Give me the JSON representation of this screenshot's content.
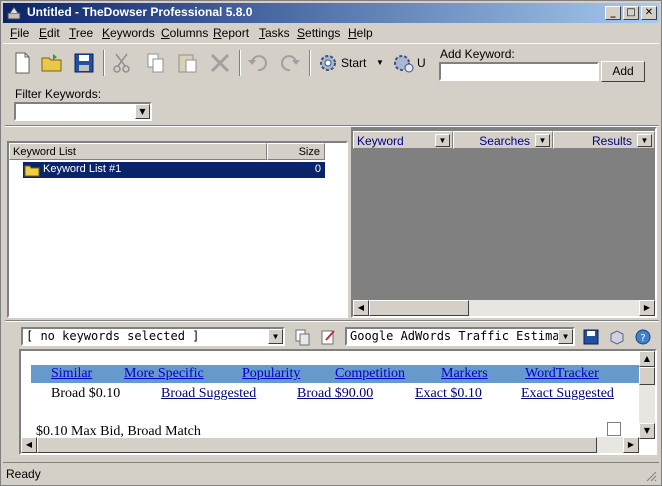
{
  "window": {
    "title": "Untitled - TheDowser Professional 5.8.0"
  },
  "menu": {
    "items": [
      {
        "label": "File",
        "ul": "F",
        "rest": "ile"
      },
      {
        "label": "Edit",
        "ul": "E",
        "rest": "dit"
      },
      {
        "label": "Tree",
        "ul": "T",
        "rest": "ree"
      },
      {
        "label": "Keywords",
        "ul": "K",
        "rest": "eywords"
      },
      {
        "label": "Columns",
        "ul": "C",
        "rest": "olumns"
      },
      {
        "label": "Report",
        "ul": "R",
        "rest": "eport"
      },
      {
        "label": "Tasks",
        "ul": "T",
        "rest": "asks"
      },
      {
        "label": "Settings",
        "ul": "S",
        "rest": "ettings"
      },
      {
        "label": "Help",
        "ul": "H",
        "rest": "elp"
      }
    ]
  },
  "toolbar": {
    "start_label": "Start",
    "update_label": "U",
    "add_keyword_label": "Add Keyword:",
    "add_keyword_value": "",
    "add_button": "Add",
    "icons": [
      "new-file-icon",
      "open-folder-icon",
      "save-icon",
      "cut-icon",
      "copy-icon",
      "paste-icon",
      "delete-icon",
      "undo-icon",
      "redo-icon",
      "gear-icon",
      "update-icon"
    ]
  },
  "filter": {
    "label": "Filter Keywords:",
    "value": ""
  },
  "keyword_list": {
    "headers": {
      "name": "Keyword List",
      "size": "Size"
    },
    "rows": [
      {
        "name": "Keyword List #1",
        "size": "0",
        "selected": true
      }
    ]
  },
  "results": {
    "headers": [
      {
        "label": "Keyword"
      },
      {
        "label": "Searches"
      },
      {
        "label": "Results"
      }
    ]
  },
  "bottom": {
    "selection_combo": "[ no keywords selected ]",
    "service_combo": "Google AdWords Traffic Estimation fo",
    "tabs": [
      "Similar",
      "More Specific",
      "Popularity",
      "Competition",
      "Markers",
      "WordTracker"
    ],
    "bid_plain": "Broad $0.10",
    "bid_links": [
      "Broad Suggested",
      "Broad $90.00",
      "Exact $0.10",
      "Exact Suggested"
    ],
    "max_bid": "$0.10 Max Bid, Broad Match"
  },
  "status": {
    "text": "Ready"
  }
}
